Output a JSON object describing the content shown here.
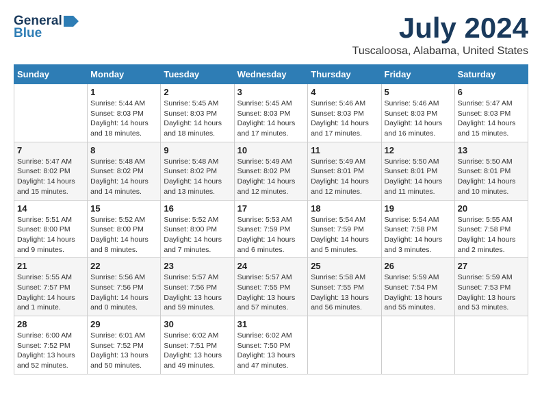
{
  "logo": {
    "general": "General",
    "blue": "Blue"
  },
  "title": "July 2024",
  "location": "Tuscaloosa, Alabama, United States",
  "weekdays": [
    "Sunday",
    "Monday",
    "Tuesday",
    "Wednesday",
    "Thursday",
    "Friday",
    "Saturday"
  ],
  "weeks": [
    [
      {
        "day": "",
        "content": ""
      },
      {
        "day": "1",
        "content": "Sunrise: 5:44 AM\nSunset: 8:03 PM\nDaylight: 14 hours\nand 18 minutes."
      },
      {
        "day": "2",
        "content": "Sunrise: 5:45 AM\nSunset: 8:03 PM\nDaylight: 14 hours\nand 18 minutes."
      },
      {
        "day": "3",
        "content": "Sunrise: 5:45 AM\nSunset: 8:03 PM\nDaylight: 14 hours\nand 17 minutes."
      },
      {
        "day": "4",
        "content": "Sunrise: 5:46 AM\nSunset: 8:03 PM\nDaylight: 14 hours\nand 17 minutes."
      },
      {
        "day": "5",
        "content": "Sunrise: 5:46 AM\nSunset: 8:03 PM\nDaylight: 14 hours\nand 16 minutes."
      },
      {
        "day": "6",
        "content": "Sunrise: 5:47 AM\nSunset: 8:03 PM\nDaylight: 14 hours\nand 15 minutes."
      }
    ],
    [
      {
        "day": "7",
        "content": "Sunrise: 5:47 AM\nSunset: 8:02 PM\nDaylight: 14 hours\nand 15 minutes."
      },
      {
        "day": "8",
        "content": "Sunrise: 5:48 AM\nSunset: 8:02 PM\nDaylight: 14 hours\nand 14 minutes."
      },
      {
        "day": "9",
        "content": "Sunrise: 5:48 AM\nSunset: 8:02 PM\nDaylight: 14 hours\nand 13 minutes."
      },
      {
        "day": "10",
        "content": "Sunrise: 5:49 AM\nSunset: 8:02 PM\nDaylight: 14 hours\nand 12 minutes."
      },
      {
        "day": "11",
        "content": "Sunrise: 5:49 AM\nSunset: 8:01 PM\nDaylight: 14 hours\nand 12 minutes."
      },
      {
        "day": "12",
        "content": "Sunrise: 5:50 AM\nSunset: 8:01 PM\nDaylight: 14 hours\nand 11 minutes."
      },
      {
        "day": "13",
        "content": "Sunrise: 5:50 AM\nSunset: 8:01 PM\nDaylight: 14 hours\nand 10 minutes."
      }
    ],
    [
      {
        "day": "14",
        "content": "Sunrise: 5:51 AM\nSunset: 8:00 PM\nDaylight: 14 hours\nand 9 minutes."
      },
      {
        "day": "15",
        "content": "Sunrise: 5:52 AM\nSunset: 8:00 PM\nDaylight: 14 hours\nand 8 minutes."
      },
      {
        "day": "16",
        "content": "Sunrise: 5:52 AM\nSunset: 8:00 PM\nDaylight: 14 hours\nand 7 minutes."
      },
      {
        "day": "17",
        "content": "Sunrise: 5:53 AM\nSunset: 7:59 PM\nDaylight: 14 hours\nand 6 minutes."
      },
      {
        "day": "18",
        "content": "Sunrise: 5:54 AM\nSunset: 7:59 PM\nDaylight: 14 hours\nand 5 minutes."
      },
      {
        "day": "19",
        "content": "Sunrise: 5:54 AM\nSunset: 7:58 PM\nDaylight: 14 hours\nand 3 minutes."
      },
      {
        "day": "20",
        "content": "Sunrise: 5:55 AM\nSunset: 7:58 PM\nDaylight: 14 hours\nand 2 minutes."
      }
    ],
    [
      {
        "day": "21",
        "content": "Sunrise: 5:55 AM\nSunset: 7:57 PM\nDaylight: 14 hours\nand 1 minute."
      },
      {
        "day": "22",
        "content": "Sunrise: 5:56 AM\nSunset: 7:56 PM\nDaylight: 14 hours\nand 0 minutes."
      },
      {
        "day": "23",
        "content": "Sunrise: 5:57 AM\nSunset: 7:56 PM\nDaylight: 13 hours\nand 59 minutes."
      },
      {
        "day": "24",
        "content": "Sunrise: 5:57 AM\nSunset: 7:55 PM\nDaylight: 13 hours\nand 57 minutes."
      },
      {
        "day": "25",
        "content": "Sunrise: 5:58 AM\nSunset: 7:55 PM\nDaylight: 13 hours\nand 56 minutes."
      },
      {
        "day": "26",
        "content": "Sunrise: 5:59 AM\nSunset: 7:54 PM\nDaylight: 13 hours\nand 55 minutes."
      },
      {
        "day": "27",
        "content": "Sunrise: 5:59 AM\nSunset: 7:53 PM\nDaylight: 13 hours\nand 53 minutes."
      }
    ],
    [
      {
        "day": "28",
        "content": "Sunrise: 6:00 AM\nSunset: 7:52 PM\nDaylight: 13 hours\nand 52 minutes."
      },
      {
        "day": "29",
        "content": "Sunrise: 6:01 AM\nSunset: 7:52 PM\nDaylight: 13 hours\nand 50 minutes."
      },
      {
        "day": "30",
        "content": "Sunrise: 6:02 AM\nSunset: 7:51 PM\nDaylight: 13 hours\nand 49 minutes."
      },
      {
        "day": "31",
        "content": "Sunrise: 6:02 AM\nSunset: 7:50 PM\nDaylight: 13 hours\nand 47 minutes."
      },
      {
        "day": "",
        "content": ""
      },
      {
        "day": "",
        "content": ""
      },
      {
        "day": "",
        "content": ""
      }
    ]
  ]
}
